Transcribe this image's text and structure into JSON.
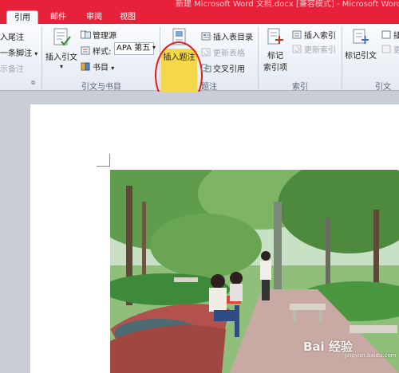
{
  "window": {
    "title": "新建 Microsoft Word 文档.docx [兼容模式] - Microsoft Word"
  },
  "tabs": [
    {
      "label": "引用",
      "active": true
    },
    {
      "label": "邮件",
      "active": false
    },
    {
      "label": "审阅",
      "active": false
    },
    {
      "label": "视图",
      "active": false
    }
  ],
  "ribbon": {
    "footnotes": {
      "insert_endnote": "入尾注",
      "next_footnote": "一条脚注",
      "show_notes": "示备注"
    },
    "citations": {
      "insert_citation": "插入引文",
      "manage_sources": "管理源",
      "style_label": "样式:",
      "style_value": "APA 第五",
      "bibliography": "书目",
      "group_label": "引文与书目"
    },
    "captions": {
      "insert_caption": "插入题注",
      "insert_table_of_figures": "插入表目录",
      "update_table": "更新表格",
      "cross_reference": "交叉引用",
      "group_label": "题注"
    },
    "index": {
      "mark_entry_line1": "标记",
      "mark_entry_line2": "索引项",
      "insert_index": "插入索引",
      "update_index": "更新索引",
      "group_label": "索引"
    },
    "authorities": {
      "mark_citation": "标记引文",
      "insert_table": "插",
      "update_table": "更",
      "group_label": "引文"
    }
  },
  "document": {
    "watermark": "Bai 经验",
    "watermark_sub": "jingyan.baidu.com"
  },
  "colors": {
    "title_red": "#e8213a",
    "highlight_yellow": "#f5d84a",
    "annotation_red": "#e11b1b"
  }
}
